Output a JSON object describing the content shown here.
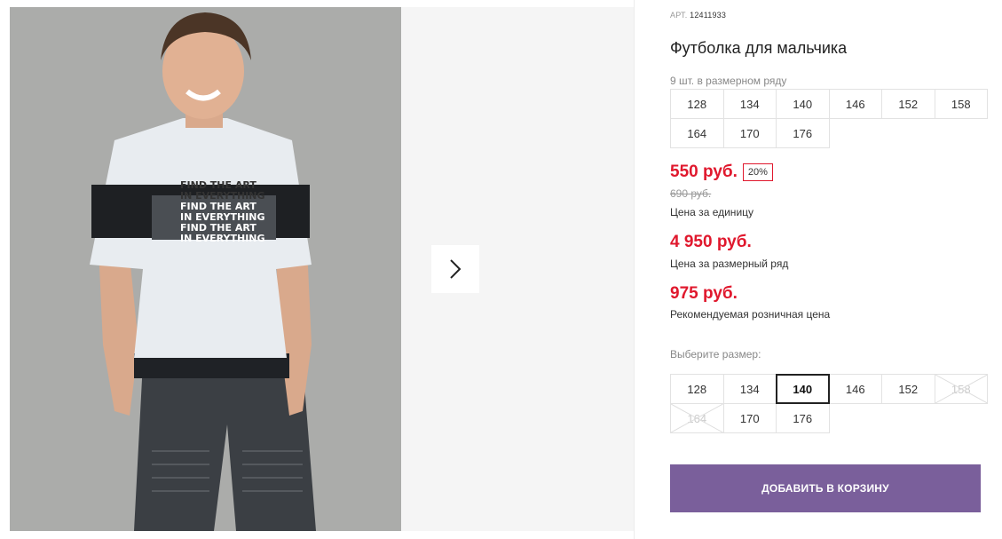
{
  "product": {
    "art_label": "АРТ.",
    "art_number": "12411933",
    "title": "Футболка для мальчика",
    "row_count_text": "9 шт. в размерном ряду"
  },
  "size_row": [
    "128",
    "134",
    "140",
    "146",
    "152",
    "158",
    "164",
    "170",
    "176"
  ],
  "prices": {
    "unit_price": "550 руб.",
    "discount_badge": "20%",
    "old_price": "690 руб.",
    "unit_label": "Цена за единицу",
    "row_price": "4 950 руб.",
    "row_label": "Цена за размерный ряд",
    "retail_price": "975 руб.",
    "retail_label": "Рекомендуемая розничная цена"
  },
  "size_select": {
    "label": "Выберите размер:",
    "sizes": [
      "128",
      "134",
      "140",
      "146",
      "152",
      "158",
      "164",
      "170",
      "176"
    ],
    "selected": "140",
    "disabled": [
      "158",
      "164"
    ]
  },
  "cart": {
    "add_label": "ДОБАВИТЬ В КОРЗИНУ"
  },
  "photo_print": {
    "line1": "FIND THE ART",
    "line2": "IN EVERYTHING"
  },
  "colors": {
    "accent_red": "#e0182d",
    "button_purple": "#7a5f9b"
  },
  "icons": {
    "next": "chevron-right-icon",
    "unavailable": "cross-out-icon"
  }
}
